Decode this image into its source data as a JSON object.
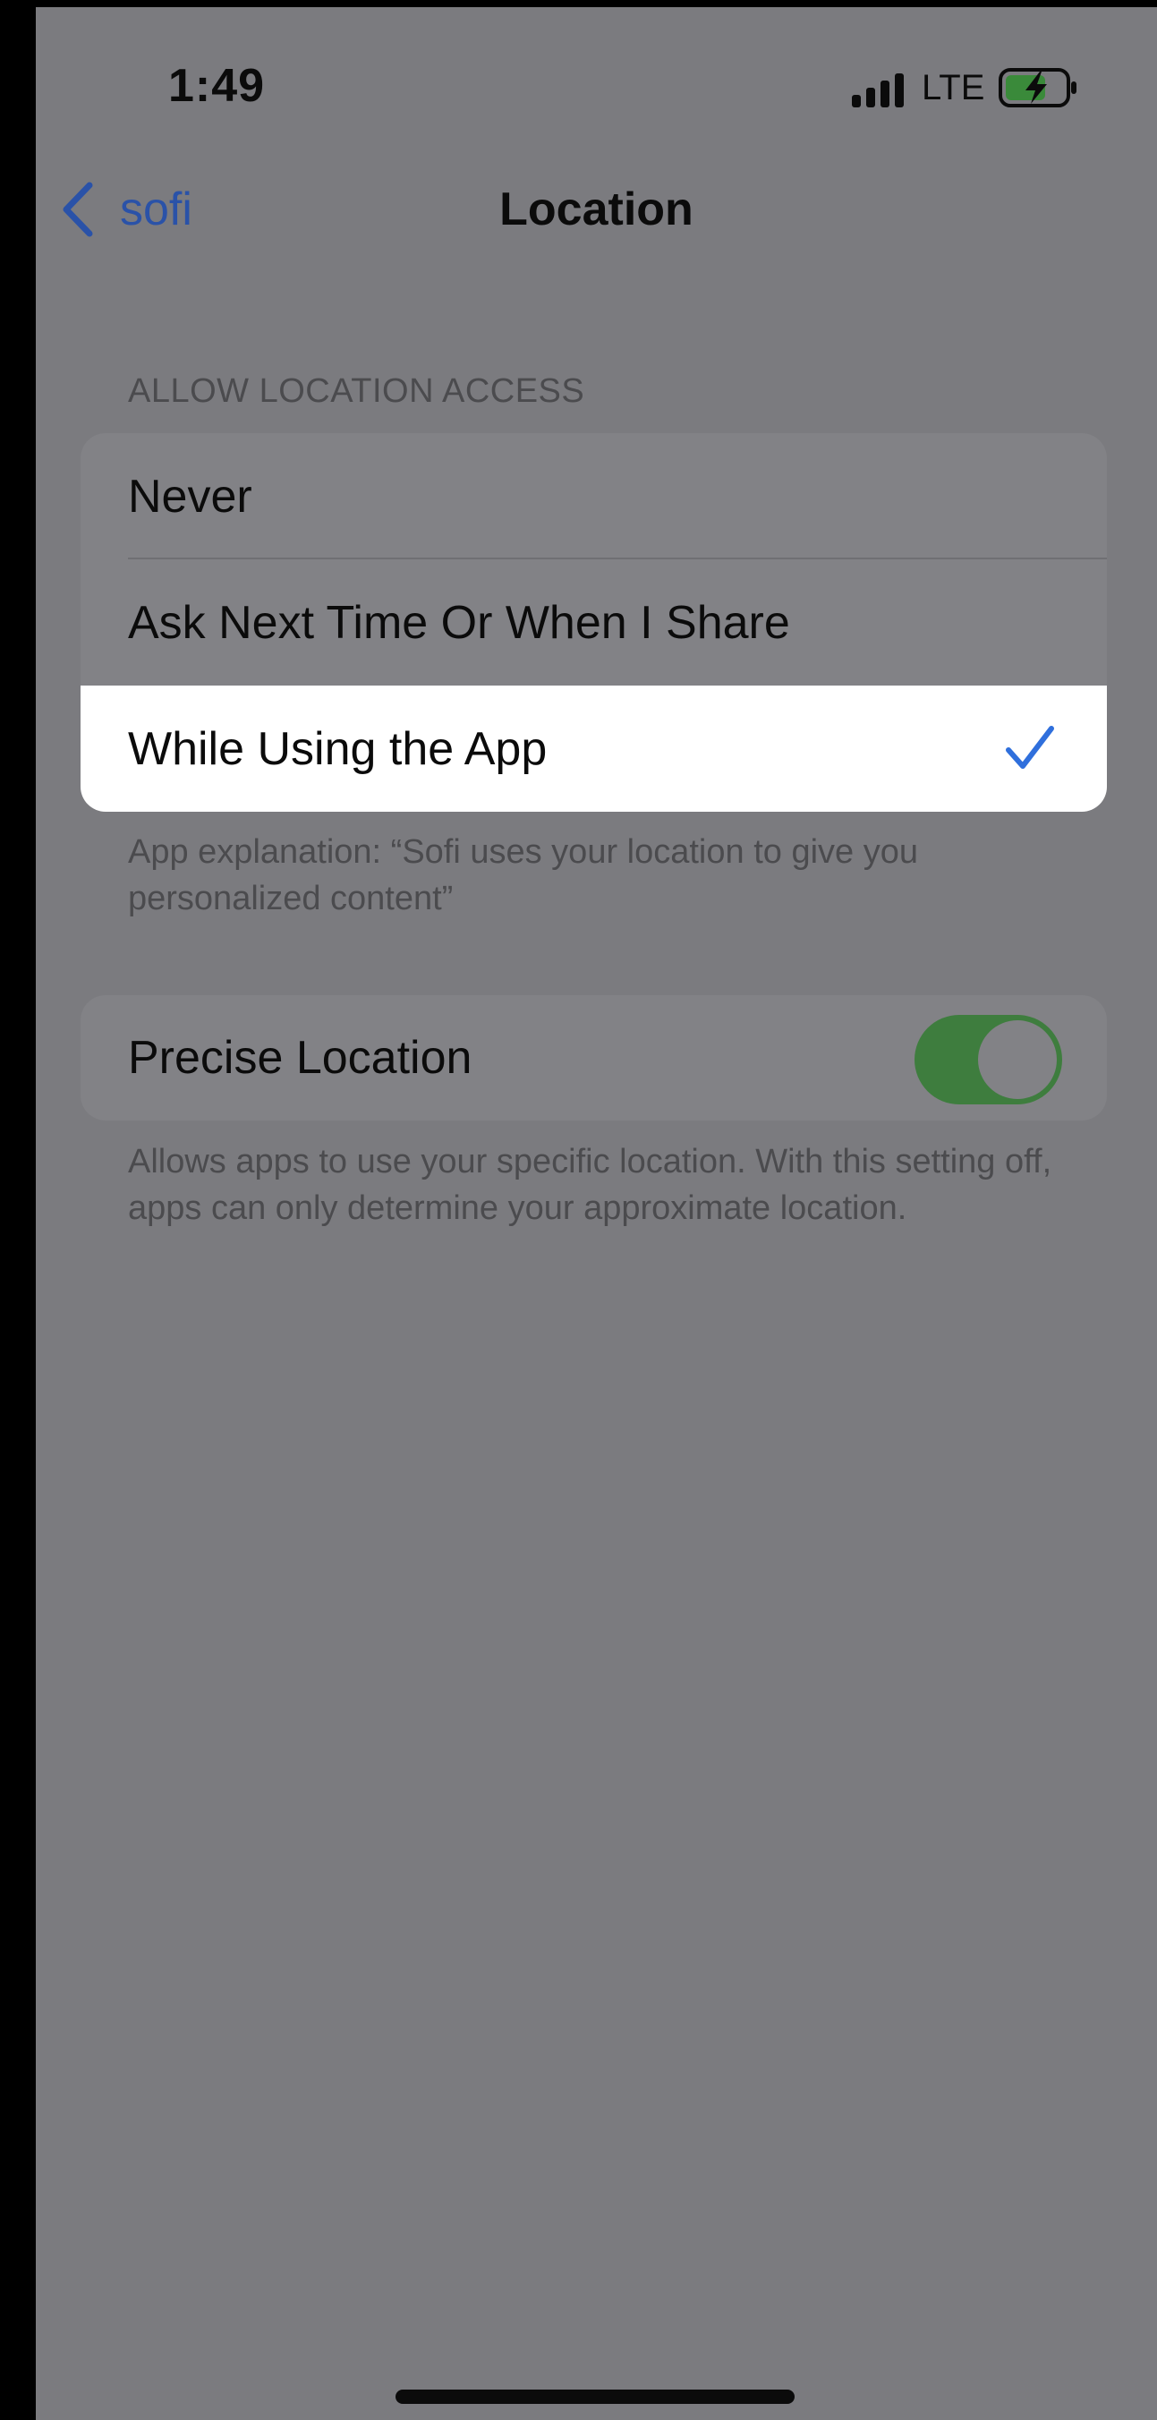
{
  "status_bar": {
    "time": "1:49",
    "network": "LTE",
    "battery_state": "charging",
    "battery_color": "#3a8a3a"
  },
  "nav": {
    "back_label": "sofi",
    "back_icon": "chevron-left-icon",
    "title": "Location"
  },
  "location_access": {
    "header": "ALLOW LOCATION ACCESS",
    "options": [
      {
        "label": "Never",
        "selected": false
      },
      {
        "label": "Ask Next Time Or When I Share",
        "selected": false
      },
      {
        "label": "While Using the App",
        "selected": true
      }
    ],
    "explanation": "App explanation: “Sofi uses your location to give you personalized content”"
  },
  "precise_location": {
    "label": "Precise Location",
    "enabled": true,
    "description": "Allows apps to use your specific location. With this setting off, apps can only determine your approximate location."
  },
  "colors": {
    "accent": "#2f6fdc",
    "toggle_on": "#3e7d3e",
    "dimmed_background": "#7b7b7f"
  }
}
